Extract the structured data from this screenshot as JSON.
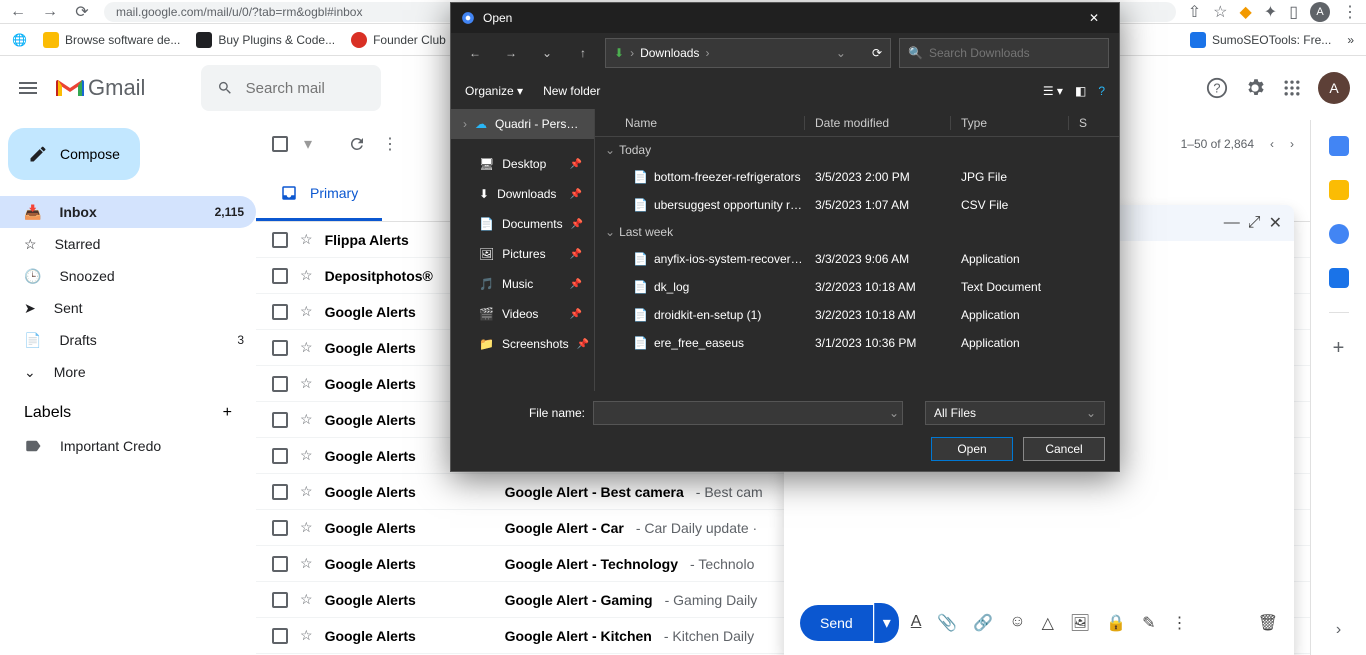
{
  "browser": {
    "url": "mail.google.com/mail/u/0/?tab=rm&ogbl#inbox",
    "avatar": "A"
  },
  "bookmarks": [
    {
      "label": "Browse software de...",
      "color": "#fbbc04"
    },
    {
      "label": "Buy Plugins & Code...",
      "color": "#202124"
    },
    {
      "label": "Founder Club",
      "color": "#d93025"
    },
    {
      "label": "SumoSEOTools: Fre...",
      "color": "#1a73e8"
    }
  ],
  "gmail": {
    "brand": "Gmail",
    "search_placeholder": "Search mail",
    "header_avatar": "A"
  },
  "sidebar": {
    "compose": "Compose",
    "items": [
      {
        "label": "Inbox",
        "count": "2,115",
        "active": true
      },
      {
        "label": "Starred"
      },
      {
        "label": "Snoozed"
      },
      {
        "label": "Sent"
      },
      {
        "label": "Drafts",
        "count": "3"
      },
      {
        "label": "More"
      }
    ],
    "labels_header": "Labels",
    "labels": [
      {
        "label": "Important Credo"
      }
    ]
  },
  "toolbar": {
    "page_info": "1–50 of 2,864"
  },
  "tabs": [
    {
      "label": "Primary",
      "active": true
    }
  ],
  "emails": [
    {
      "sender": "Flippa Alerts"
    },
    {
      "sender": "Depositphotos®"
    },
    {
      "sender": "Google Alerts"
    },
    {
      "sender": "Google Alerts"
    },
    {
      "sender": "Google Alerts"
    },
    {
      "sender": "Google Alerts"
    },
    {
      "sender": "Google Alerts"
    },
    {
      "sender": "Google Alerts",
      "subject": "Google Alert - Best camera",
      "snippet": " - Best cam"
    },
    {
      "sender": "Google Alerts",
      "subject": "Google Alert - Car",
      "snippet": " - Car Daily update ·"
    },
    {
      "sender": "Google Alerts",
      "subject": "Google Alert - Technology",
      "snippet": " - Technolo"
    },
    {
      "sender": "Google Alerts",
      "subject": "Google Alert - Gaming",
      "snippet": " - Gaming Daily"
    },
    {
      "sender": "Google Alerts",
      "subject": "Google Alert - Kitchen",
      "snippet": " - Kitchen Daily"
    }
  ],
  "compose": {
    "send": "Send"
  },
  "dialog": {
    "title": "Open",
    "path_label": "Downloads",
    "search_placeholder": "Search Downloads",
    "organize": "Organize",
    "new_folder": "New folder",
    "tree_selected": "Quadri - Persona",
    "tree": [
      {
        "label": "Desktop"
      },
      {
        "label": "Downloads"
      },
      {
        "label": "Documents"
      },
      {
        "label": "Pictures"
      },
      {
        "label": "Music"
      },
      {
        "label": "Videos"
      },
      {
        "label": "Screenshots"
      }
    ],
    "cols": {
      "name": "Name",
      "date": "Date modified",
      "type": "Type",
      "size": "S"
    },
    "groups": [
      {
        "title": "Today",
        "rows": [
          {
            "name": "bottom-freezer-refrigerators",
            "date": "3/5/2023 2:00 PM",
            "type": "JPG File"
          },
          {
            "name": "ubersuggest opportunity ref...",
            "date": "3/5/2023 1:07 AM",
            "type": "CSV File"
          }
        ]
      },
      {
        "title": "Last week",
        "rows": [
          {
            "name": "anyfix-ios-system-recovery-...",
            "date": "3/3/2023 9:06 AM",
            "type": "Application"
          },
          {
            "name": "dk_log",
            "date": "3/2/2023 10:18 AM",
            "type": "Text Document"
          },
          {
            "name": "droidkit-en-setup (1)",
            "date": "3/2/2023 10:18 AM",
            "type": "Application"
          },
          {
            "name": "ere_free_easeus",
            "date": "3/1/2023 10:36 PM",
            "type": "Application"
          }
        ]
      }
    ],
    "filename_label": "File name:",
    "filter": "All Files",
    "open": "Open",
    "cancel": "Cancel"
  }
}
